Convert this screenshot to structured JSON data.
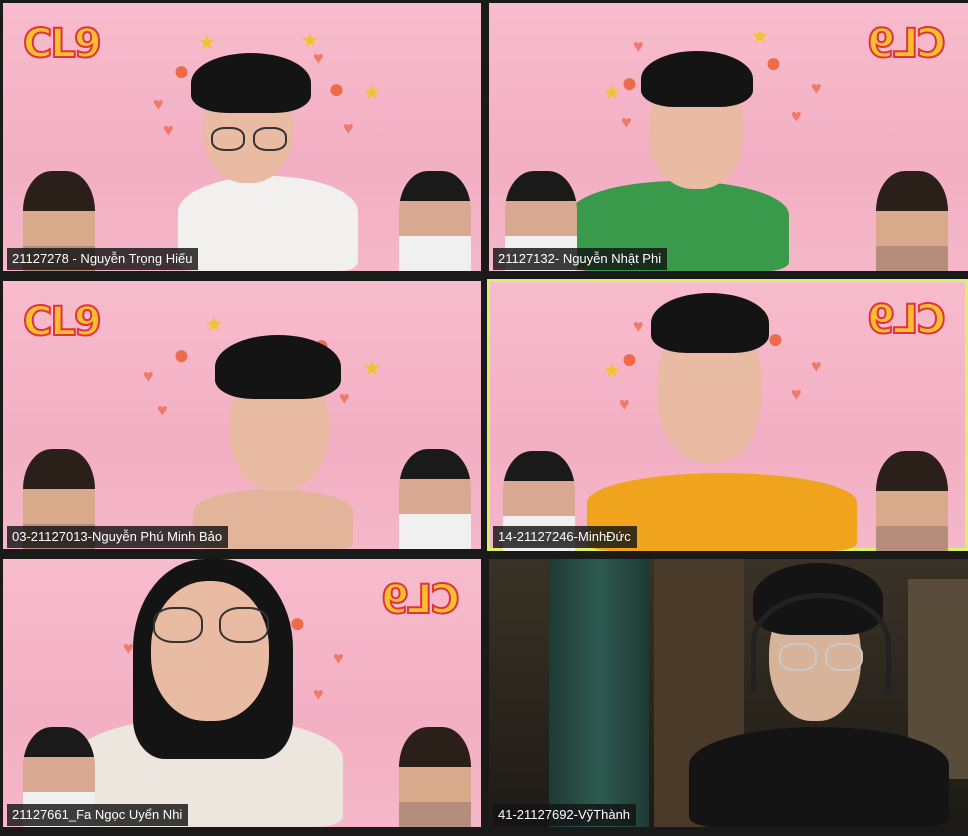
{
  "meeting": {
    "logo_text": "CL9",
    "participants": [
      {
        "name": "21127278 - Nguyễn Trọng Hiếu",
        "active": false
      },
      {
        "name": "21127132- Nguyễn Nhật Phi",
        "active": false
      },
      {
        "name": "03-21127013-Nguyễn Phú Minh Bảo",
        "active": false
      },
      {
        "name": "14-21127246-MinhĐức",
        "active": true
      },
      {
        "name": "21127661_Fa Ngọc Uyển Nhi",
        "active": false
      },
      {
        "name": "41-21127692-VỹThành",
        "active": false
      }
    ]
  },
  "colors": {
    "active_border": "#d9f06a",
    "background_pink": "#f4b6c8",
    "logo_fill": "#f6c12d",
    "logo_stroke": "#e2323e"
  }
}
